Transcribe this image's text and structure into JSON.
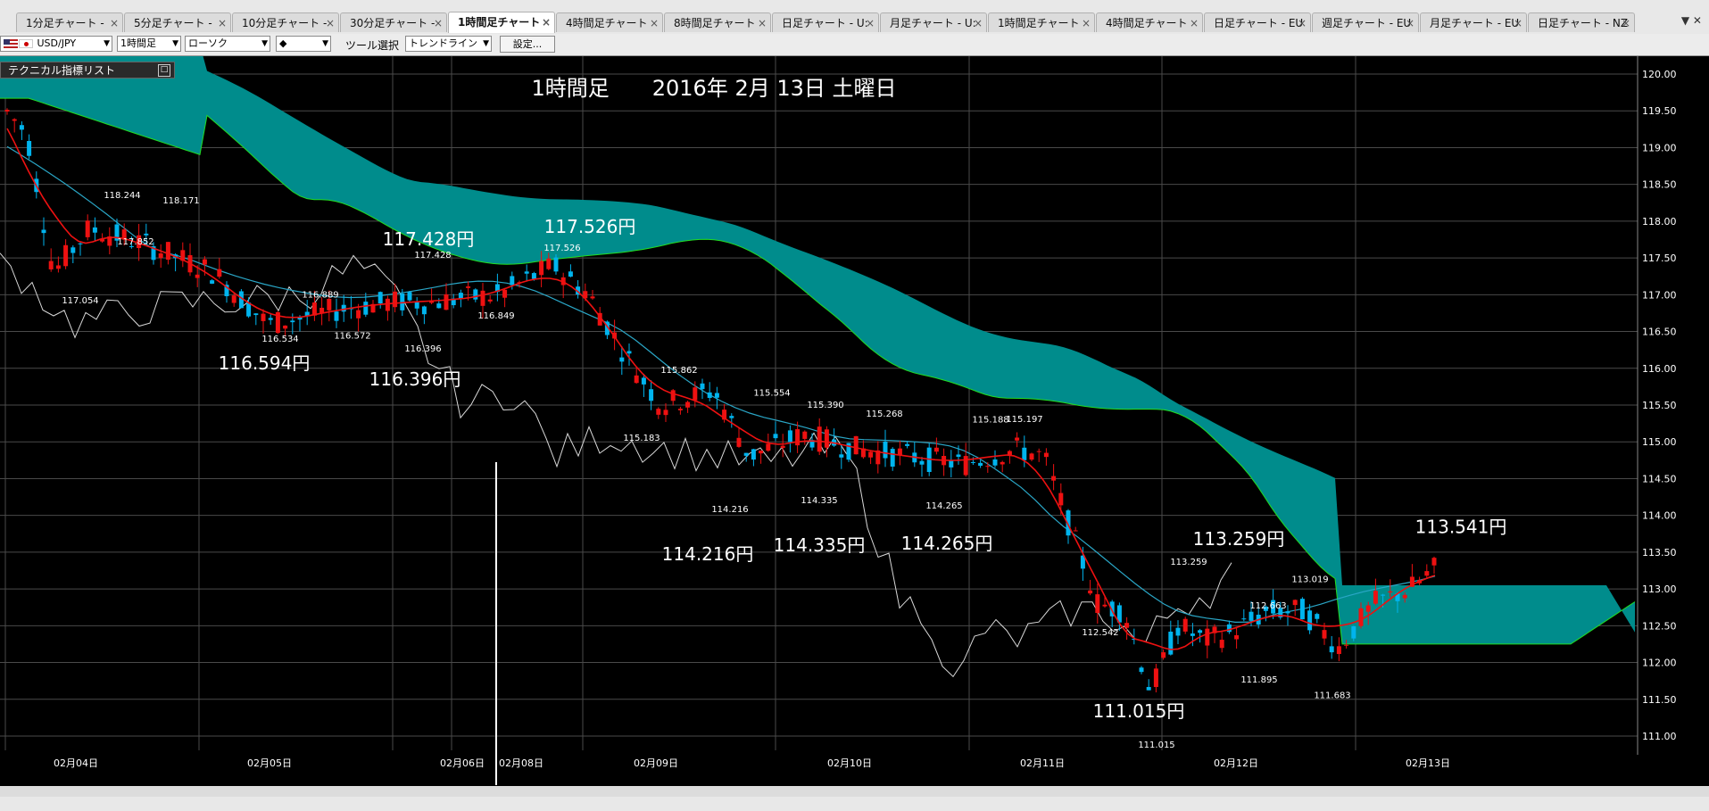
{
  "tabs": [
    {
      "label": "1分足チャート - "
    },
    {
      "label": "5分足チャート - "
    },
    {
      "label": "10分足チャート - "
    },
    {
      "label": "30分足チャート - "
    },
    {
      "label": "1時間足チャート",
      "active": true
    },
    {
      "label": "4時間足チャート"
    },
    {
      "label": "8時間足チャート"
    },
    {
      "label": "日足チャート - U:"
    },
    {
      "label": "月足チャート - U:"
    },
    {
      "label": "1時間足チャート"
    },
    {
      "label": "4時間足チャート"
    },
    {
      "label": "日足チャート - EU"
    },
    {
      "label": "週足チャート - EU"
    },
    {
      "label": "月足チャート - EU"
    },
    {
      "label": "日足チャート - NZ"
    }
  ],
  "tab_close_glyph": "×",
  "tab_menu_glyph": "▼ ✕",
  "toolbar": {
    "pair": "USD/JPY",
    "timeframe": "1時間足",
    "chart_type": "ローソク",
    "style_glyph": "◆",
    "tool_label": "ツール選択",
    "tool_value": "トレンドライン",
    "settings_label": "設定..."
  },
  "indicator_panel": {
    "label": "テクニカル指標リスト",
    "button": "□"
  },
  "colors": {
    "background": "#000000",
    "up_candle": "#ee1111",
    "down_candle": "#00b4ee",
    "cloud_fill": "#008c8c",
    "cloud_edge": "#22dd22",
    "tenkan": "#ee1111",
    "kijun": "#2aa6c6",
    "chikou": "#d8d8d8",
    "grid": "#4a4a4a",
    "axis_text": "#ffffff"
  },
  "chart_data": {
    "type": "candlestick",
    "instrument": "USD/JPY",
    "timeframe": "1時間足",
    "title": "1時間足　　2016年 2月 13日 土曜日",
    "ylim": [
      111.0,
      120.0
    ],
    "y_ticks": [
      "120.00",
      "119.50",
      "119.00",
      "118.50",
      "118.00",
      "117.50",
      "117.00",
      "116.50",
      "116.00",
      "115.50",
      "115.00",
      "114.50",
      "114.00",
      "113.50",
      "113.00",
      "112.50",
      "112.00",
      "111.50",
      "111.00"
    ],
    "x_ticks": [
      "02月04日",
      "02月05日",
      "02月06日",
      "02月08日",
      "02月09日",
      "02月10日",
      "02月11日",
      "02月12日",
      "02月13日"
    ],
    "extrema_labels": [
      {
        "text": "118.244",
        "date": "02月04日",
        "price": 118.244
      },
      {
        "text": "118.171",
        "date": "02月04日",
        "price": 118.171
      },
      {
        "text": "117.852",
        "date": "02月04日",
        "price": 117.852
      },
      {
        "text": "117.054",
        "date": "02月04日",
        "price": 117.054
      },
      {
        "text": "116.534",
        "date": "02月05日",
        "price": 116.534
      },
      {
        "text": "116.889",
        "date": "02月05日",
        "price": 116.889
      },
      {
        "text": "116.572",
        "date": "02月05日",
        "price": 116.572
      },
      {
        "text": "117.428",
        "date": "02月05日",
        "price": 117.428
      },
      {
        "text": "116.396",
        "date": "02月05日",
        "price": 116.396
      },
      {
        "text": "116.849",
        "date": "02月08日",
        "price": 116.849
      },
      {
        "text": "117.526",
        "date": "02月08日",
        "price": 117.526
      },
      {
        "text": "115.862",
        "date": "02月09日",
        "price": 115.862
      },
      {
        "text": "115.183",
        "date": "02月09日",
        "price": 115.183
      },
      {
        "text": "115.554",
        "date": "02月09日",
        "price": 115.554
      },
      {
        "text": "115.390",
        "date": "02月09日",
        "price": 115.39
      },
      {
        "text": "114.216",
        "date": "02月09日",
        "price": 114.216
      },
      {
        "text": "114.335",
        "date": "02月09日",
        "price": 114.335
      },
      {
        "text": "115.268",
        "date": "02月10日",
        "price": 115.268
      },
      {
        "text": "114.265",
        "date": "02月10日",
        "price": 114.265
      },
      {
        "text": "115.188",
        "date": "02月10日",
        "price": 115.188
      },
      {
        "text": "115.197",
        "date": "02月10日",
        "price": 115.197
      },
      {
        "text": "113.259",
        "date": "02月11日",
        "price": 113.259
      },
      {
        "text": "112.542",
        "date": "02月11日",
        "price": 112.542
      },
      {
        "text": "111.015",
        "date": "02月11日",
        "price": 111.015
      },
      {
        "text": "112.663",
        "date": "02月12日",
        "price": 112.663
      },
      {
        "text": "113.019",
        "date": "02月12日",
        "price": 113.019
      },
      {
        "text": "111.895",
        "date": "02月12日",
        "price": 111.895
      },
      {
        "text": "111.683",
        "date": "02月12日",
        "price": 111.683
      }
    ],
    "callouts": [
      {
        "text": "117.428円",
        "price": 117.428
      },
      {
        "text": "117.526円",
        "price": 117.526
      },
      {
        "text": "116.594円",
        "price": 116.594
      },
      {
        "text": "116.396円",
        "price": 116.396
      },
      {
        "text": "114.216円",
        "price": 114.216
      },
      {
        "text": "114.335円",
        "price": 114.335
      },
      {
        "text": "114.265円",
        "price": 114.265
      },
      {
        "text": "113.259円",
        "price": 113.259
      },
      {
        "text": "111.015円",
        "price": 111.015
      },
      {
        "text": "113.541円",
        "price": 113.541
      }
    ],
    "price_series_approx": {
      "description_points": [
        [
          0,
          119.6
        ],
        [
          30,
          119.2
        ],
        [
          60,
          117.3
        ],
        [
          100,
          117.9
        ],
        [
          160,
          117.7
        ],
        [
          240,
          117.3
        ],
        [
          300,
          116.6
        ],
        [
          380,
          116.8
        ],
        [
          440,
          116.9
        ],
        [
          480,
          116.9
        ],
        [
          560,
          117.0
        ],
        [
          620,
          117.4
        ],
        [
          660,
          117.0
        ],
        [
          700,
          116.2
        ],
        [
          740,
          115.5
        ],
        [
          800,
          115.7
        ],
        [
          840,
          114.8
        ],
        [
          900,
          115.1
        ],
        [
          960,
          114.9
        ],
        [
          1020,
          114.8
        ],
        [
          1080,
          114.7
        ],
        [
          1140,
          114.9
        ],
        [
          1170,
          114.8
        ],
        [
          1200,
          113.8
        ],
        [
          1230,
          112.8
        ],
        [
          1260,
          112.7
        ],
        [
          1290,
          111.6
        ],
        [
          1320,
          112.5
        ],
        [
          1350,
          112.3
        ],
        [
          1380,
          112.4
        ],
        [
          1420,
          112.7
        ],
        [
          1460,
          112.7
        ],
        [
          1500,
          112.2
        ],
        [
          1540,
          112.8
        ],
        [
          1580,
          113.0
        ],
        [
          1610,
          113.3
        ]
      ]
    }
  }
}
